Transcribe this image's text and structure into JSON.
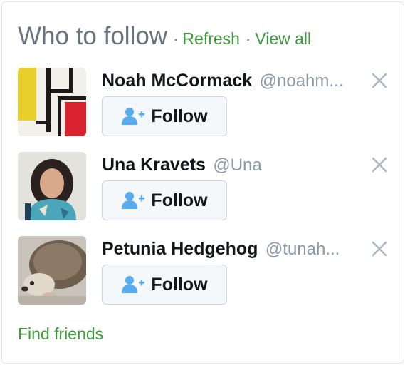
{
  "header": {
    "title": "Who to follow",
    "separator": "·",
    "refresh_label": "Refresh",
    "view_all_label": "View all"
  },
  "suggestions": [
    {
      "name": "Noah McCormack",
      "handle": "@noahm...",
      "follow_label": "Follow",
      "avatar": "mondrian-abstract"
    },
    {
      "name": "Una Kravets",
      "handle": "@Una",
      "follow_label": "Follow",
      "avatar": "woman-portrait"
    },
    {
      "name": "Petunia Hedgehog",
      "handle": "@tunah...",
      "follow_label": "Follow",
      "avatar": "hedgehog-photo"
    }
  ],
  "footer": {
    "find_friends_label": "Find friends"
  },
  "colors": {
    "link": "#3e9b3c",
    "title": "#66757f",
    "icon_blue": "#55acee",
    "dismiss_gray": "#aab8c2"
  },
  "icons": {
    "follow": "add-person-icon",
    "dismiss": "close-icon"
  }
}
